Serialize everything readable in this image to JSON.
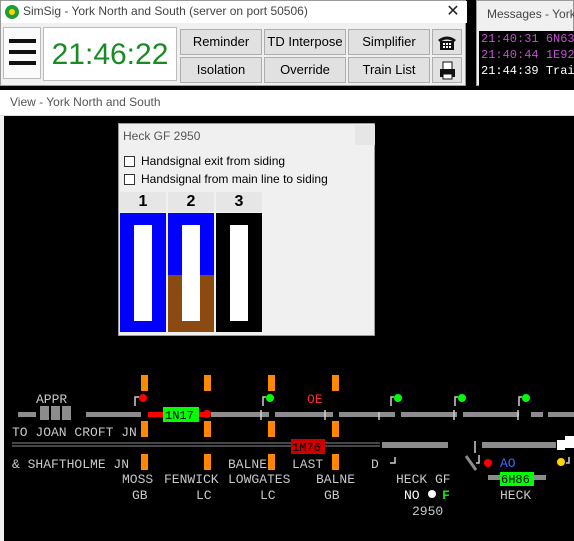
{
  "main_window": {
    "title": "SimSig - York North and South (server on port 50506)",
    "clock": "21:46:22",
    "buttons": {
      "reminder": "Reminder",
      "td_interpose": "TD Interpose",
      "simplifier": "Simplifier",
      "isolation": "Isolation",
      "override": "Override",
      "train_list": "Train List"
    },
    "icons": [
      "app-icon",
      "close-icon",
      "menu-icon",
      "telephone-icon",
      "printer-icon"
    ]
  },
  "messages_window": {
    "title": "Messages - York",
    "lines": [
      {
        "time": "21:40:31",
        "text": "6N63",
        "color": "#c050d0"
      },
      {
        "time": "21:40:44",
        "text": "1E92",
        "color": "#c050d0"
      },
      {
        "time": "21:44:39",
        "text": "Train",
        "color": "#ffffff"
      }
    ]
  },
  "view_window": {
    "title": "View - York North and South"
  },
  "dialog": {
    "title": "Heck GF 2950",
    "checkboxes": [
      "Handsignal exit from siding",
      "Handsignal from main line to siding"
    ],
    "levers": [
      {
        "number": "1",
        "color": "#0000ff",
        "lower_color": "#0000ff"
      },
      {
        "number": "2",
        "color": "#0000ff",
        "lower_color": "#8b4a12"
      },
      {
        "number": "3",
        "color": "#000000",
        "lower_color": "#000000"
      }
    ]
  },
  "diagram": {
    "labels": {
      "appr": "APPR",
      "joan_croft": "TO JOAN CROFT JN",
      "shaftholme": "& SHAFTHOLME JN",
      "moss1": "MOSS",
      "moss2": "GB",
      "fenwick1": "FENWICK",
      "fenwick2": "LC",
      "balne_low1": "BALNE",
      "balne_low2": "LOWGATES",
      "balne_low3": "LC",
      "last": "LAST",
      "balne_gb1": "BALNE",
      "balne_gb2": "GB",
      "d": "D",
      "heck_gf": "HECK GF",
      "no": "NO",
      "f": "F",
      "num2950": "2950",
      "heck": "HECK",
      "ao": "AO",
      "oe": "OE"
    },
    "berths": {
      "b1": "1N17",
      "b2": "1M76",
      "b3": "6H86"
    },
    "colors": {
      "track": "#8c8c8c",
      "route_set": "#ff0000",
      "signal_green": "#00ff00",
      "signal_red": "#ff0000",
      "crossing_orange": "#ff8800",
      "berth_green": "#00ff00",
      "berth_red": "#cc0000"
    }
  }
}
